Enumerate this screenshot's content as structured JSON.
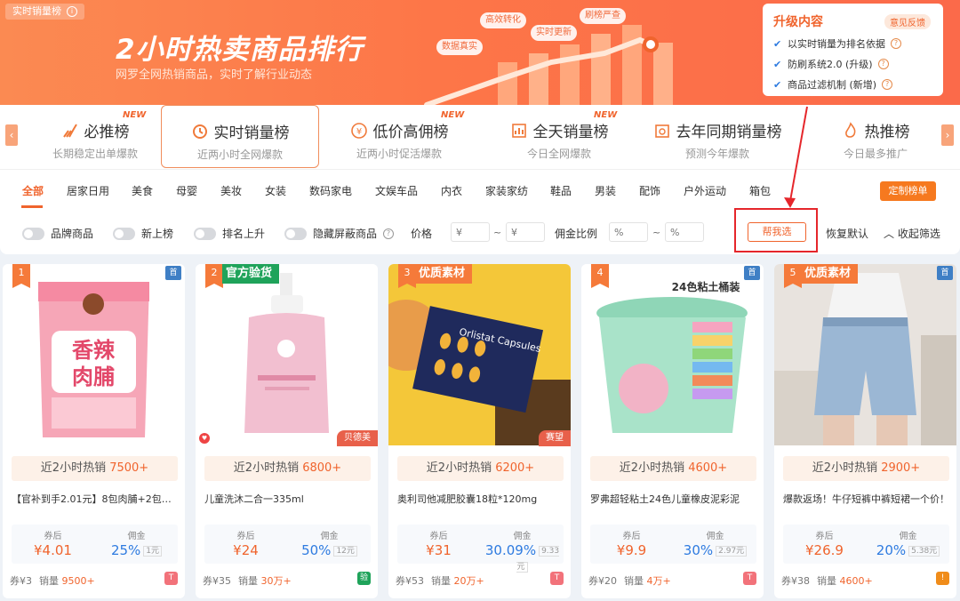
{
  "banner": {
    "tag": "实时销量榜",
    "title": "2小时热卖商品排行",
    "subtitle": "网罗全网热销商品，实时了解行业动态",
    "bubbles": [
      "高效转化",
      "刷榜严查",
      "实时更新",
      "数据真实"
    ]
  },
  "upgrade": {
    "title": "升级内容",
    "feedback": "意见反馈",
    "items": [
      "以实时销量为排名依据",
      "防刷系统2.0 (升级)",
      "商品过滤机制 (新增)"
    ]
  },
  "rank_tabs": [
    {
      "name": "必推榜",
      "sub": "长期稳定出单爆款",
      "new": "NEW",
      "icon": "rocket-icon"
    },
    {
      "name": "实时销量榜",
      "sub": "近两小时全网爆款",
      "new": "",
      "icon": "clock-icon"
    },
    {
      "name": "低价高佣榜",
      "sub": "近两小时促活爆款",
      "new": "NEW",
      "icon": "yen-icon"
    },
    {
      "name": "全天销量榜",
      "sub": "今日全网爆款",
      "new": "NEW",
      "icon": "chart-icon"
    },
    {
      "name": "去年同期销量榜",
      "sub": "预测今年爆款",
      "new": "",
      "icon": "calendar-icon"
    },
    {
      "name": "热推榜",
      "sub": "今日最多推广",
      "new": "",
      "icon": "flame-icon"
    }
  ],
  "categories": [
    "全部",
    "居家日用",
    "美食",
    "母婴",
    "美妆",
    "女装",
    "数码家电",
    "文娱车品",
    "内衣",
    "家装家纺",
    "鞋品",
    "男装",
    "配饰",
    "户外运动",
    "箱包"
  ],
  "custom_button": "定制榜单",
  "filters": {
    "toggles": [
      "品牌商品",
      "新上榜",
      "排名上升",
      "隐藏屏蔽商品"
    ],
    "price_label": "价格",
    "commission_label": "佣金比例",
    "price_min_placeholder": "¥",
    "price_max_placeholder": "¥",
    "comm_min_placeholder": "%",
    "comm_max_placeholder": "%",
    "tilde": "~",
    "help_pick": "帮我选",
    "reset": "恢复默认",
    "collapse": "收起筛选"
  },
  "products": [
    {
      "rank": "1",
      "badge": "",
      "badge_color": "orange",
      "shou": "首",
      "shop_tag": "",
      "sales_prefix": "近2小时热销",
      "sales": "7500+",
      "title": "【官补到手2.01元】8包肉脯+2包素...",
      "price_label": "券后",
      "price": "¥4.01",
      "comm_label": "佣金",
      "comm": "25%",
      "comm_old": "1元",
      "coupon": "券¥3",
      "volume_label": "销量",
      "volume": "9500+",
      "foot_icon": "T",
      "foot_color": "#f2727a",
      "has_heart": false
    },
    {
      "rank": "2",
      "badge": "官方验货",
      "badge_color": "green",
      "shou": "",
      "shop_tag": "贝德美",
      "sales_prefix": "近2小时热销",
      "sales": "6800+",
      "title": "儿童洗沐二合一335ml",
      "price_label": "券后",
      "price": "¥24",
      "comm_label": "佣金",
      "comm": "50%",
      "comm_old": "12元",
      "coupon": "券¥35",
      "volume_label": "销量",
      "volume": "30万+",
      "foot_icon": "验",
      "foot_color": "#1fa35a",
      "has_heart": true
    },
    {
      "rank": "3",
      "badge": "优质素材",
      "badge_color": "orange",
      "shou": "",
      "shop_tag": "赛望",
      "sales_prefix": "近2小时热销",
      "sales": "6200+",
      "title": "奥利司他减肥胶囊18粒*120mg",
      "price_label": "券后",
      "price": "¥31",
      "comm_label": "佣金",
      "comm": "30.09%",
      "comm_old": "9.33元",
      "coupon": "券¥53",
      "volume_label": "销量",
      "volume": "20万+",
      "foot_icon": "T",
      "foot_color": "#f2727a",
      "has_heart": false
    },
    {
      "rank": "4",
      "badge": "",
      "badge_color": "orange",
      "shou": "首",
      "shop_tag": "",
      "sales_prefix": "近2小时热销",
      "sales": "4600+",
      "title": "罗弗超轻粘土24色儿童橡皮泥彩泥",
      "price_label": "券后",
      "price": "¥9.9",
      "comm_label": "佣金",
      "comm": "30%",
      "comm_old": "2.97元",
      "coupon": "券¥20",
      "volume_label": "销量",
      "volume": "4万+",
      "foot_icon": "T",
      "foot_color": "#f2727a",
      "has_heart": false
    },
    {
      "rank": "5",
      "badge": "优质素材",
      "badge_color": "orange",
      "shou": "首",
      "shop_tag": "",
      "sales_prefix": "近2小时热销",
      "sales": "2900+",
      "title": "爆款返场！牛仔短裤中裤短裙一个价！",
      "price_label": "券后",
      "price": "¥26.9",
      "comm_label": "佣金",
      "comm": "20%",
      "comm_old": "5.38元",
      "coupon": "券¥38",
      "volume_label": "销量",
      "volume": "4600+",
      "foot_icon": "!",
      "foot_color": "#f08c1a",
      "has_heart": false
    }
  ],
  "colors": {
    "accent": "#f0642d",
    "banner": "#fc7a4c",
    "highlight_box": "#e5262b",
    "commission": "#2e7be0"
  }
}
